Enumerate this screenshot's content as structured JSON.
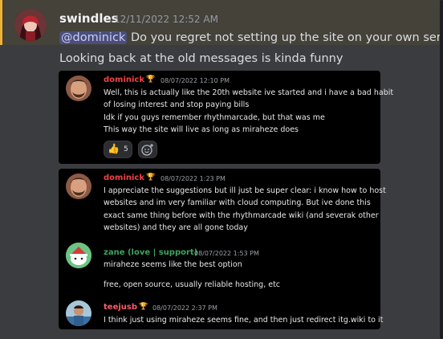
{
  "author": {
    "name": "swindles",
    "timestamp": "12/11/2022 12:52 AM"
  },
  "message": {
    "mention": "@dominick",
    "line1": "Do you regret not setting up the site on your own server",
    "line2": "Looking back at the old messages is kinda funny"
  },
  "screenshot1": {
    "author": "dominick",
    "time": "08/07/2022 12:10 PM",
    "lines": [
      "Well, this is actually like the 20th website ive started and i have a bad habit",
      "of losing interest and stop paying bills",
      "Idk if you guys remember rhythmarcade, but that was me",
      "This way the site will live as long as miraheze does"
    ],
    "reaction": {
      "emoji": "👍",
      "count": "5"
    }
  },
  "screenshot2": {
    "msg1": {
      "author": "dominick",
      "time": "08/07/2022 1:23 PM",
      "lines": [
        "I appreciate the suggestions but ill just be super clear: i know how to host",
        "websites and im very familiar with cloud computing. But ive done this",
        "exact same thing before with the rhythmarcade wiki (and severak other",
        "websites) and they are all gone today"
      ]
    },
    "msg2": {
      "author": "zane (love | support)",
      "time": "08/07/2022 1:53 PM",
      "lines": [
        "miraheze seems like the best option",
        "free, open source, usually reliable hosting, etc"
      ]
    },
    "msg3": {
      "author": "teejusb",
      "time": "08/07/2022 2:37 PM",
      "lines": [
        "I think just using miraheze seems fine, and then just redirect itg.wiki to it"
      ]
    }
  },
  "colors": {
    "dominick": "#ed4245",
    "zane": "#3ba55d",
    "teejusb": "#ff5c6c",
    "mention_bg": "#4a4f8c"
  }
}
